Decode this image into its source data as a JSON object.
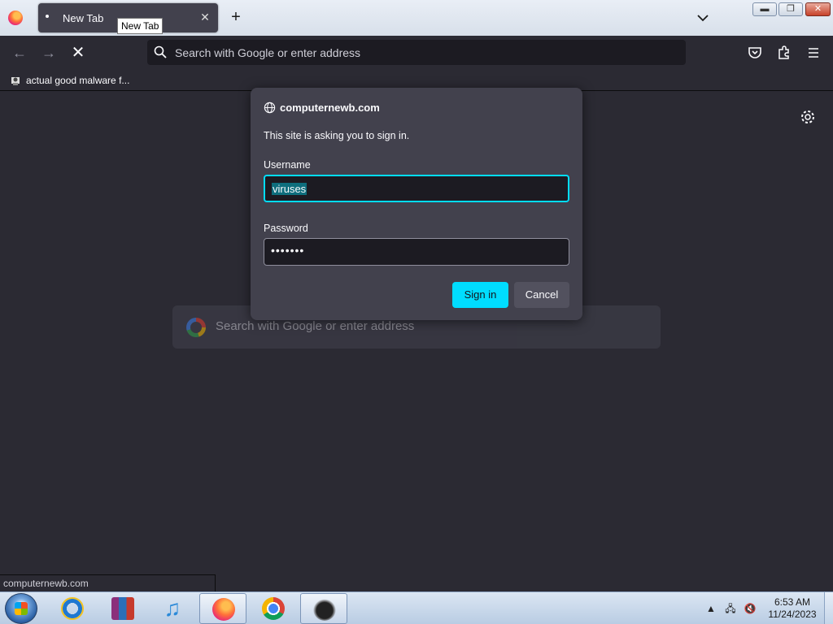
{
  "tabs": [
    {
      "title": "New Tab",
      "tooltip": "New Tab"
    }
  ],
  "toolbar": {
    "url_placeholder": "Search with Google or enter address"
  },
  "bookmarks": [
    {
      "label": "actual good malware f..."
    }
  ],
  "page": {
    "search_placeholder": "Search with Google or enter address"
  },
  "dialog": {
    "origin": "computernewb.com",
    "message": "This site is asking you to sign in.",
    "username_label": "Username",
    "username_value": "viruses",
    "password_label": "Password",
    "password_value": "•••••••",
    "signin_label": "Sign in",
    "cancel_label": "Cancel"
  },
  "status_text": "computernewb.com",
  "taskbar": {
    "apps": [
      "internet-explorer",
      "winrar",
      "itunes",
      "firefox",
      "chrome",
      "unknown-app"
    ],
    "active_app": "firefox",
    "time": "6:53 AM",
    "date": "11/24/2023"
  },
  "colors": {
    "accent": "#00ddff",
    "dialog_bg": "#42414d",
    "page_bg": "#2b2a33"
  }
}
